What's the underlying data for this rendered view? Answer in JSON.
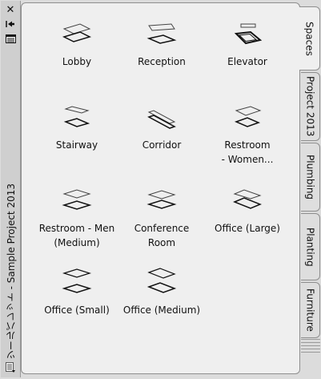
{
  "palette": {
    "title": "ツールパレット - Sample Project 2013",
    "tools": [
      {
        "label": "Lobby",
        "icon": "lobby-space-icon"
      },
      {
        "label": "Reception",
        "icon": "reception-space-icon"
      },
      {
        "label": "Elevator",
        "icon": "elevator-space-icon"
      },
      {
        "label": "Stairway",
        "icon": "stairway-space-icon"
      },
      {
        "label": "Corridor",
        "icon": "corridor-space-icon"
      },
      {
        "label": "Restroom\n- Women...",
        "icon": "restroom-women-space-icon"
      },
      {
        "label": "Restroom - Men\n(Medium)",
        "icon": "restroom-men-space-icon"
      },
      {
        "label": "Conference\nRoom",
        "icon": "conference-room-space-icon"
      },
      {
        "label": "Office (Large)",
        "icon": "office-large-space-icon"
      },
      {
        "label": "Office (Small)",
        "icon": "office-small-space-icon"
      },
      {
        "label": "Office (Medium)",
        "icon": "office-medium-space-icon"
      }
    ],
    "tabs": [
      {
        "label": "Spaces",
        "active": true
      },
      {
        "label": "Project 2013",
        "active": false
      },
      {
        "label": "Plumbing",
        "active": false
      },
      {
        "label": "Planting",
        "active": false
      },
      {
        "label": "Furniture",
        "active": false
      }
    ]
  },
  "titlebar": {
    "close_icon": "close-icon",
    "autohide_icon": "auto-hide-icon",
    "properties_icon": "properties-icon",
    "menu_icon": "palette-menu-icon"
  }
}
